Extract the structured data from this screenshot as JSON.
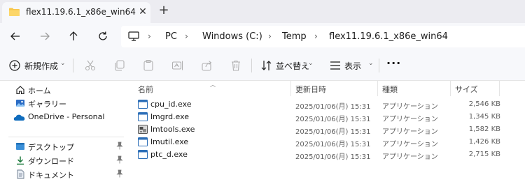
{
  "tab": {
    "title": "flex11.19.6.1_x86e_win64",
    "close_glyph": "✕",
    "new_glyph": "+"
  },
  "breadcrumb": {
    "items": [
      "PC",
      "Windows  (C:)",
      "Temp",
      "flex11.19.6.1_x86e_win64"
    ],
    "separator": "›"
  },
  "toolbar": {
    "new_label": "新規作成",
    "sort_label": "並べ替え",
    "view_label": "表示",
    "more_label": "···",
    "chevron": "⌄"
  },
  "sidebar": {
    "items": [
      {
        "label": "ホーム",
        "icon": "home-icon"
      },
      {
        "label": "ギャラリー",
        "icon": "gallery-icon"
      },
      {
        "label": "OneDrive - Personal",
        "icon": "onedrive-icon"
      },
      {
        "label": "デスクトップ",
        "icon": "desktop-icon"
      },
      {
        "label": "ダウンロード",
        "icon": "download-icon"
      },
      {
        "label": "ドキュメント",
        "icon": "documents-icon"
      }
    ]
  },
  "columns": {
    "name": "名前",
    "modified": "更新日時",
    "type": "種類",
    "size": "サイズ"
  },
  "files": [
    {
      "name": "cpu_id.exe",
      "modified": "2025/01/06(月) 15:31",
      "type": "アプリケーション",
      "size": "2,546 KB",
      "icon": "exe-icon"
    },
    {
      "name": "lmgrd.exe",
      "modified": "2025/01/06(月) 15:31",
      "type": "アプリケーション",
      "size": "1,345 KB",
      "icon": "exe-icon"
    },
    {
      "name": "lmtools.exe",
      "modified": "2025/01/06(月) 15:31",
      "type": "アプリケーション",
      "size": "1,582 KB",
      "icon": "lmtools-app-icon"
    },
    {
      "name": "lmutil.exe",
      "modified": "2025/01/06(月) 15:31",
      "type": "アプリケーション",
      "size": "1,426 KB",
      "icon": "exe-icon"
    },
    {
      "name": "ptc_d.exe",
      "modified": "2025/01/06(月) 15:31",
      "type": "アプリケーション",
      "size": "2,715 KB",
      "icon": "exe-icon"
    }
  ],
  "colors": {
    "accent": "#0067c0",
    "folder": "#f8c64b",
    "tabstrip": "#ececf1",
    "toolbar": "#f7f8fb"
  }
}
